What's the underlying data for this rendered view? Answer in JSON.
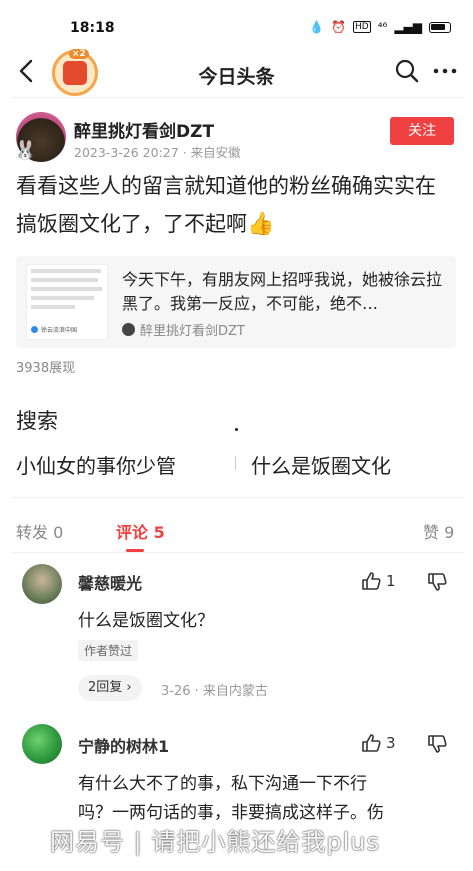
{
  "status_bar": {
    "time": "18:18",
    "signal": "⁴⁶"
  },
  "nav": {
    "title": "今日头条",
    "logo_badge": "×2",
    "icons": [
      "back-arrow-icon",
      "search-icon",
      "more-icon"
    ]
  },
  "post": {
    "author_name": "醉里挑灯看剑DZT",
    "meta": "2023-3-26 20:27 · 来自安徽",
    "follow_label": "关注",
    "text": "看看这些人的留言就知道他的粉丝确确实实在搞饭圈文化了，了不起啊",
    "text_emoji": "👍",
    "quote": {
      "text": "今天下午，有朋友网上招呼我说，她被徐云拉黑了。我第一反应，不可能，绝不…",
      "author": "醉里挑灯看剑DZT",
      "thumb_footer": "徐云流浪中国"
    },
    "views": "3938展现"
  },
  "search": {
    "label": "搜索",
    "terms": [
      "小仙女的事你少管",
      "什么是饭圈文化"
    ]
  },
  "tabs": {
    "forward": "转发 0",
    "comment": "评论 5",
    "like": "赞 9"
  },
  "comments": [
    {
      "name": "馨慈暖光",
      "likes": "1",
      "text": "什么是饭圈文化？",
      "author_liked": "作者赞过",
      "replies": "2回复",
      "meta": "3-26 · 来自内蒙古"
    },
    {
      "name": "宁静的树林1",
      "likes": "3",
      "text_line1": "有什么大不了的事，私下沟通一下不行",
      "text_line2": "吗？一两句话的事，非要搞成这样子。伤"
    }
  ],
  "watermark": "网易号 | 请把小熊还给我plus",
  "colors": {
    "accent": "#f04142",
    "muted": "#888888"
  }
}
